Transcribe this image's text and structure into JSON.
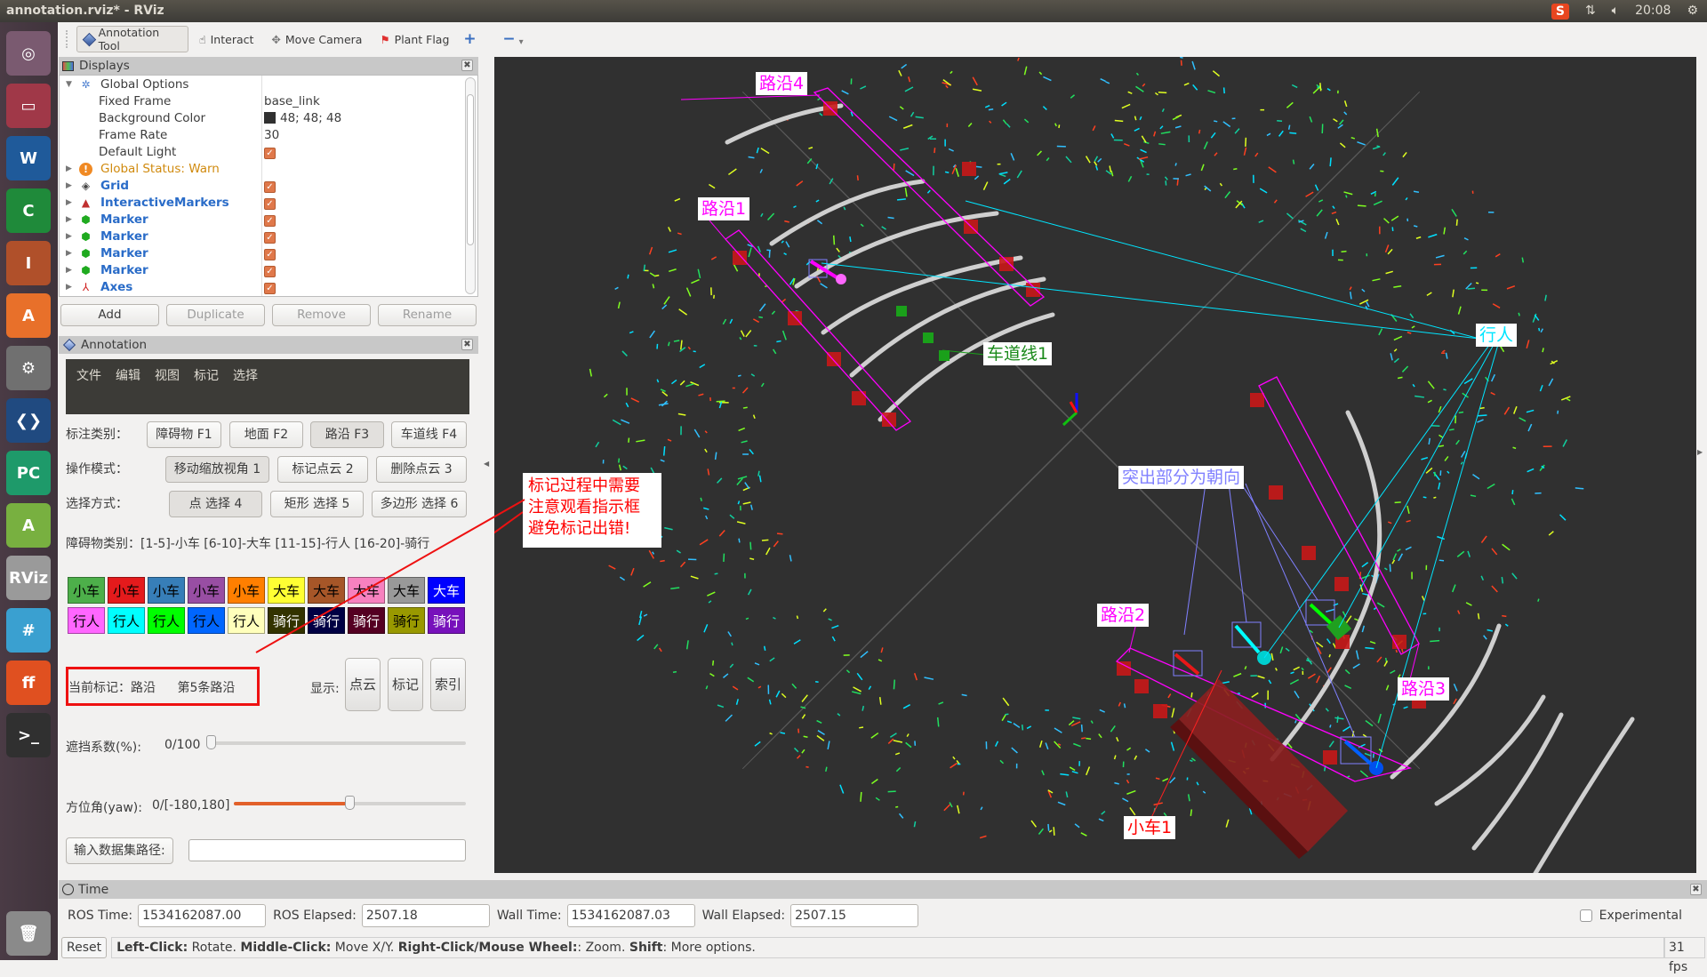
{
  "window": {
    "title": "annotation.rviz* - RViz"
  },
  "tray": {
    "input_method": "S",
    "network_icon": "network-updown-icon",
    "volume_icon": "volume-icon",
    "clock": "20:08",
    "power_icon": "power-gear-icon"
  },
  "launcher": {
    "apps": [
      {
        "name": "ubuntu-dash",
        "label": "◎"
      },
      {
        "name": "files",
        "label": "▭"
      },
      {
        "name": "libreoffice-writer",
        "label": "W"
      },
      {
        "name": "libreoffice-calc",
        "label": "C"
      },
      {
        "name": "libreoffice-impress",
        "label": "I"
      },
      {
        "name": "software-center",
        "label": "A"
      },
      {
        "name": "system-settings",
        "label": "⚙"
      },
      {
        "name": "vscode",
        "label": "❮❯"
      },
      {
        "name": "pycharm",
        "label": "PC"
      },
      {
        "name": "android-studio",
        "label": "A"
      },
      {
        "name": "rviz",
        "label": "RViz"
      },
      {
        "name": "mono-develop",
        "label": "#"
      },
      {
        "name": "firefox",
        "label": "ff"
      },
      {
        "name": "terminal",
        "label": ">_"
      },
      {
        "name": "trash",
        "label": "🗑"
      }
    ]
  },
  "toolbar": {
    "tools": [
      {
        "label": "Annotation Tool",
        "icon": "diamond-icon",
        "active": true
      },
      {
        "label": "Interact",
        "icon": "hand-pointer-icon",
        "active": false
      },
      {
        "label": "Move Camera",
        "icon": "move-camera-icon",
        "active": false
      },
      {
        "label": "Plant Flag",
        "icon": "flag-icon",
        "active": false
      }
    ],
    "add_tool": "+",
    "remove_tool": "−",
    "dropdown": "▾"
  },
  "displays": {
    "title": "Displays",
    "rows": [
      {
        "label": "Global Options",
        "value": "",
        "expanded": true
      },
      {
        "label": "Fixed Frame",
        "value": "base_link"
      },
      {
        "label": "Background Color",
        "value": "48; 48; 48",
        "swatch": "#303030"
      },
      {
        "label": "Frame Rate",
        "value": "30"
      },
      {
        "label": "Default Light",
        "checked": true
      },
      {
        "label": "Global Status: Warn",
        "value": ""
      },
      {
        "label": "Grid",
        "checked": true
      },
      {
        "label": "InteractiveMarkers",
        "checked": true
      },
      {
        "label": "Marker",
        "checked": true
      },
      {
        "label": "Marker",
        "checked": true
      },
      {
        "label": "Marker",
        "checked": true
      },
      {
        "label": "Marker",
        "checked": true
      },
      {
        "label": "Axes",
        "checked": true
      }
    ],
    "buttons": {
      "add": "Add",
      "duplicate": "Duplicate",
      "remove": "Remove",
      "rename": "Rename"
    }
  },
  "annotation": {
    "title": "Annotation",
    "menu": [
      "文件",
      "编辑",
      "视图",
      "标记",
      "选择"
    ],
    "category": {
      "label": "标注类别：",
      "buttons": [
        "障碍物 F1",
        "地面 F2",
        "路沿 F3",
        "车道线 F4"
      ],
      "selected": "路沿 F3"
    },
    "mode": {
      "label": "操作模式：",
      "buttons": [
        "移动缩放视角 1",
        "标记点云 2",
        "删除点云 3"
      ],
      "selected": "移动缩放视角 1"
    },
    "select": {
      "label": "选择方式：",
      "buttons": [
        "点 选择 4",
        "矩形 选择 5",
        "多边形 选择 6"
      ],
      "selected": "点 选择 4"
    },
    "obstacle_legend": "障碍物类别：[1-5]-小车   [6-10]-大车   [11-15]-行人   [16-20]-骑行",
    "class_buttons": [
      {
        "label": "小车",
        "bg": "#4daf4a",
        "fg": "#000000"
      },
      {
        "label": "小车",
        "bg": "#e41a1c",
        "fg": "#000000"
      },
      {
        "label": "小车",
        "bg": "#377eb8",
        "fg": "#000000"
      },
      {
        "label": "小车",
        "bg": "#984ea3",
        "fg": "#000000"
      },
      {
        "label": "小车",
        "bg": "#ff7f00",
        "fg": "#000000"
      },
      {
        "label": "大车",
        "bg": "#ffff33",
        "fg": "#000000"
      },
      {
        "label": "大车",
        "bg": "#a65628",
        "fg": "#000000"
      },
      {
        "label": "大车",
        "bg": "#f781bf",
        "fg": "#000000"
      },
      {
        "label": "大车",
        "bg": "#999999",
        "fg": "#000000"
      },
      {
        "label": "大车",
        "bg": "#0000ff",
        "fg": "#ffffff"
      },
      {
        "label": "行人",
        "bg": "#ff66ff",
        "fg": "#000000"
      },
      {
        "label": "行人",
        "bg": "#00ffff",
        "fg": "#000000"
      },
      {
        "label": "行人",
        "bg": "#00ff00",
        "fg": "#000000"
      },
      {
        "label": "行人",
        "bg": "#0066ff",
        "fg": "#000000"
      },
      {
        "label": "行人",
        "bg": "#ffffbb",
        "fg": "#000000"
      },
      {
        "label": "骑行",
        "bg": "#333300",
        "fg": "#ffffff"
      },
      {
        "label": "骑行",
        "bg": "#000044",
        "fg": "#ffffff"
      },
      {
        "label": "骑行",
        "bg": "#550022",
        "fg": "#ffffff"
      },
      {
        "label": "骑行",
        "bg": "#999900",
        "fg": "#000000"
      },
      {
        "label": "骑行",
        "bg": "#7711bb",
        "fg": "#ffffff"
      }
    ],
    "current_mark": {
      "label": "当前标记：路沿",
      "detail": "第5条路沿"
    },
    "show": {
      "label": "显示:",
      "buttons": [
        "点云",
        "标记",
        "索引"
      ]
    },
    "occlusion": {
      "label": "遮挡系数(%):",
      "value_text": "0/100",
      "value": 0,
      "min": 0,
      "max": 100
    },
    "yaw": {
      "label": "方位角(yaw):",
      "value_text": "0/[-180,180]",
      "value": 0,
      "min": -180,
      "max": 180
    },
    "dataset": {
      "button": "输入数据集路径:",
      "value": ""
    }
  },
  "viewport": {
    "labels": [
      {
        "id": "curb4",
        "text": "路沿4",
        "color": "#ff00ff"
      },
      {
        "id": "curb1",
        "text": "路沿1",
        "color": "#ff00ff"
      },
      {
        "id": "lane1",
        "text": "车道线1",
        "color": "#1a8a1a"
      },
      {
        "id": "pedestrian",
        "text": "行人",
        "color": "#00e5ff"
      },
      {
        "id": "heading-note",
        "text": "突出部分为朝向",
        "color": "#8080ff"
      },
      {
        "id": "curb2",
        "text": "路沿2",
        "color": "#ff00ff"
      },
      {
        "id": "curb3",
        "text": "路沿3",
        "color": "#ff00ff"
      },
      {
        "id": "car1",
        "text": "小车1",
        "color": "#ff0000"
      }
    ],
    "note": {
      "lines": [
        "标记过程中需要",
        "注意观看指示框",
        "避免标记出错!"
      ],
      "color": "#ff0000"
    }
  },
  "time": {
    "title": "Time",
    "ros_time_label": "ROS Time:",
    "ros_time": "1534162087.00",
    "ros_elapsed_label": "ROS Elapsed:",
    "ros_elapsed": "2507.18",
    "wall_time_label": "Wall Time:",
    "wall_time": "1534162087.03",
    "wall_elapsed_label": "Wall Elapsed:",
    "wall_elapsed": "2507.15",
    "experimental_label": "Experimental",
    "experimental_checked": false
  },
  "status": {
    "reset": "Reset",
    "hint_parts": [
      {
        "b": "Left-Click:",
        "t": " Rotate. "
      },
      {
        "b": "Middle-Click:",
        "t": " Move X/Y. "
      },
      {
        "b": "Right-Click/Mouse Wheel:",
        "t": ": Zoom. "
      },
      {
        "b": "Shift",
        "t": ": More options."
      }
    ],
    "fps": "31 fps"
  }
}
